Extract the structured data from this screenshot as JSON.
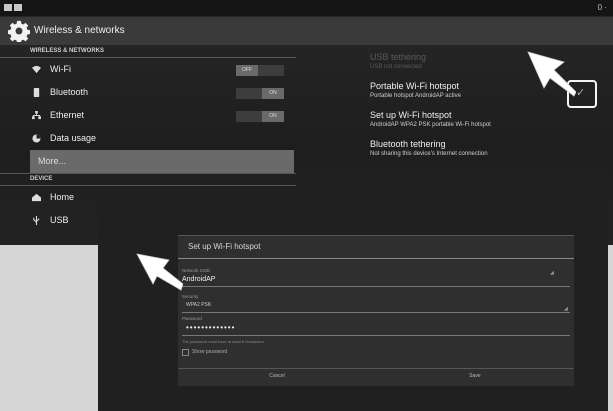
{
  "screen1": {
    "action_bar": {
      "title": "Wireless & networks",
      "icon": "gear-icon"
    },
    "sections": [
      {
        "header": "WIRELESS & NETWORKS"
      },
      {
        "header": "DEVICE"
      }
    ],
    "items": {
      "wifi": {
        "label": "Wi-Fi",
        "toggle": "OFF"
      },
      "bluetooth": {
        "label": "Bluetooth",
        "toggle": "ON"
      },
      "ethernet": {
        "label": "Ethernet",
        "toggle": "ON"
      },
      "data_usage": {
        "label": "Data usage"
      },
      "more": {
        "label": "More..."
      },
      "home": {
        "label": "Home"
      },
      "usb": {
        "label": "USB"
      }
    },
    "right": [
      {
        "title": "USB tethering",
        "sub": "USB not connected"
      },
      {
        "title": "Portable Wi-Fi hotspot",
        "sub": "Portable hotspot AndroidAP active"
      },
      {
        "title": "Set up Wi-Fi hotspot",
        "sub": "AndroidAP WPA2 PSK portable Wi-Fi hotspot"
      },
      {
        "title": "Bluetooth tethering",
        "sub": "Not sharing this device's Internet connection"
      }
    ]
  },
  "screen2": {
    "dialog": {
      "title": "Set up Wi-Fi hotspot",
      "ssid_label": "Network SSID",
      "ssid_value": "AndroidAP",
      "security_label": "Security",
      "security_value": "WPA2 PSK",
      "password_label": "Password",
      "password_value": "•••••••••••••",
      "password_note": "The password must have at least 8 characters.",
      "show_password_label": "Show password",
      "cancel_label": "Cancel",
      "save_label": "Save"
    }
  },
  "colors": {
    "dark_bg": "#222222",
    "selected": "#6a6a6a",
    "arrow": "#ffffff"
  }
}
